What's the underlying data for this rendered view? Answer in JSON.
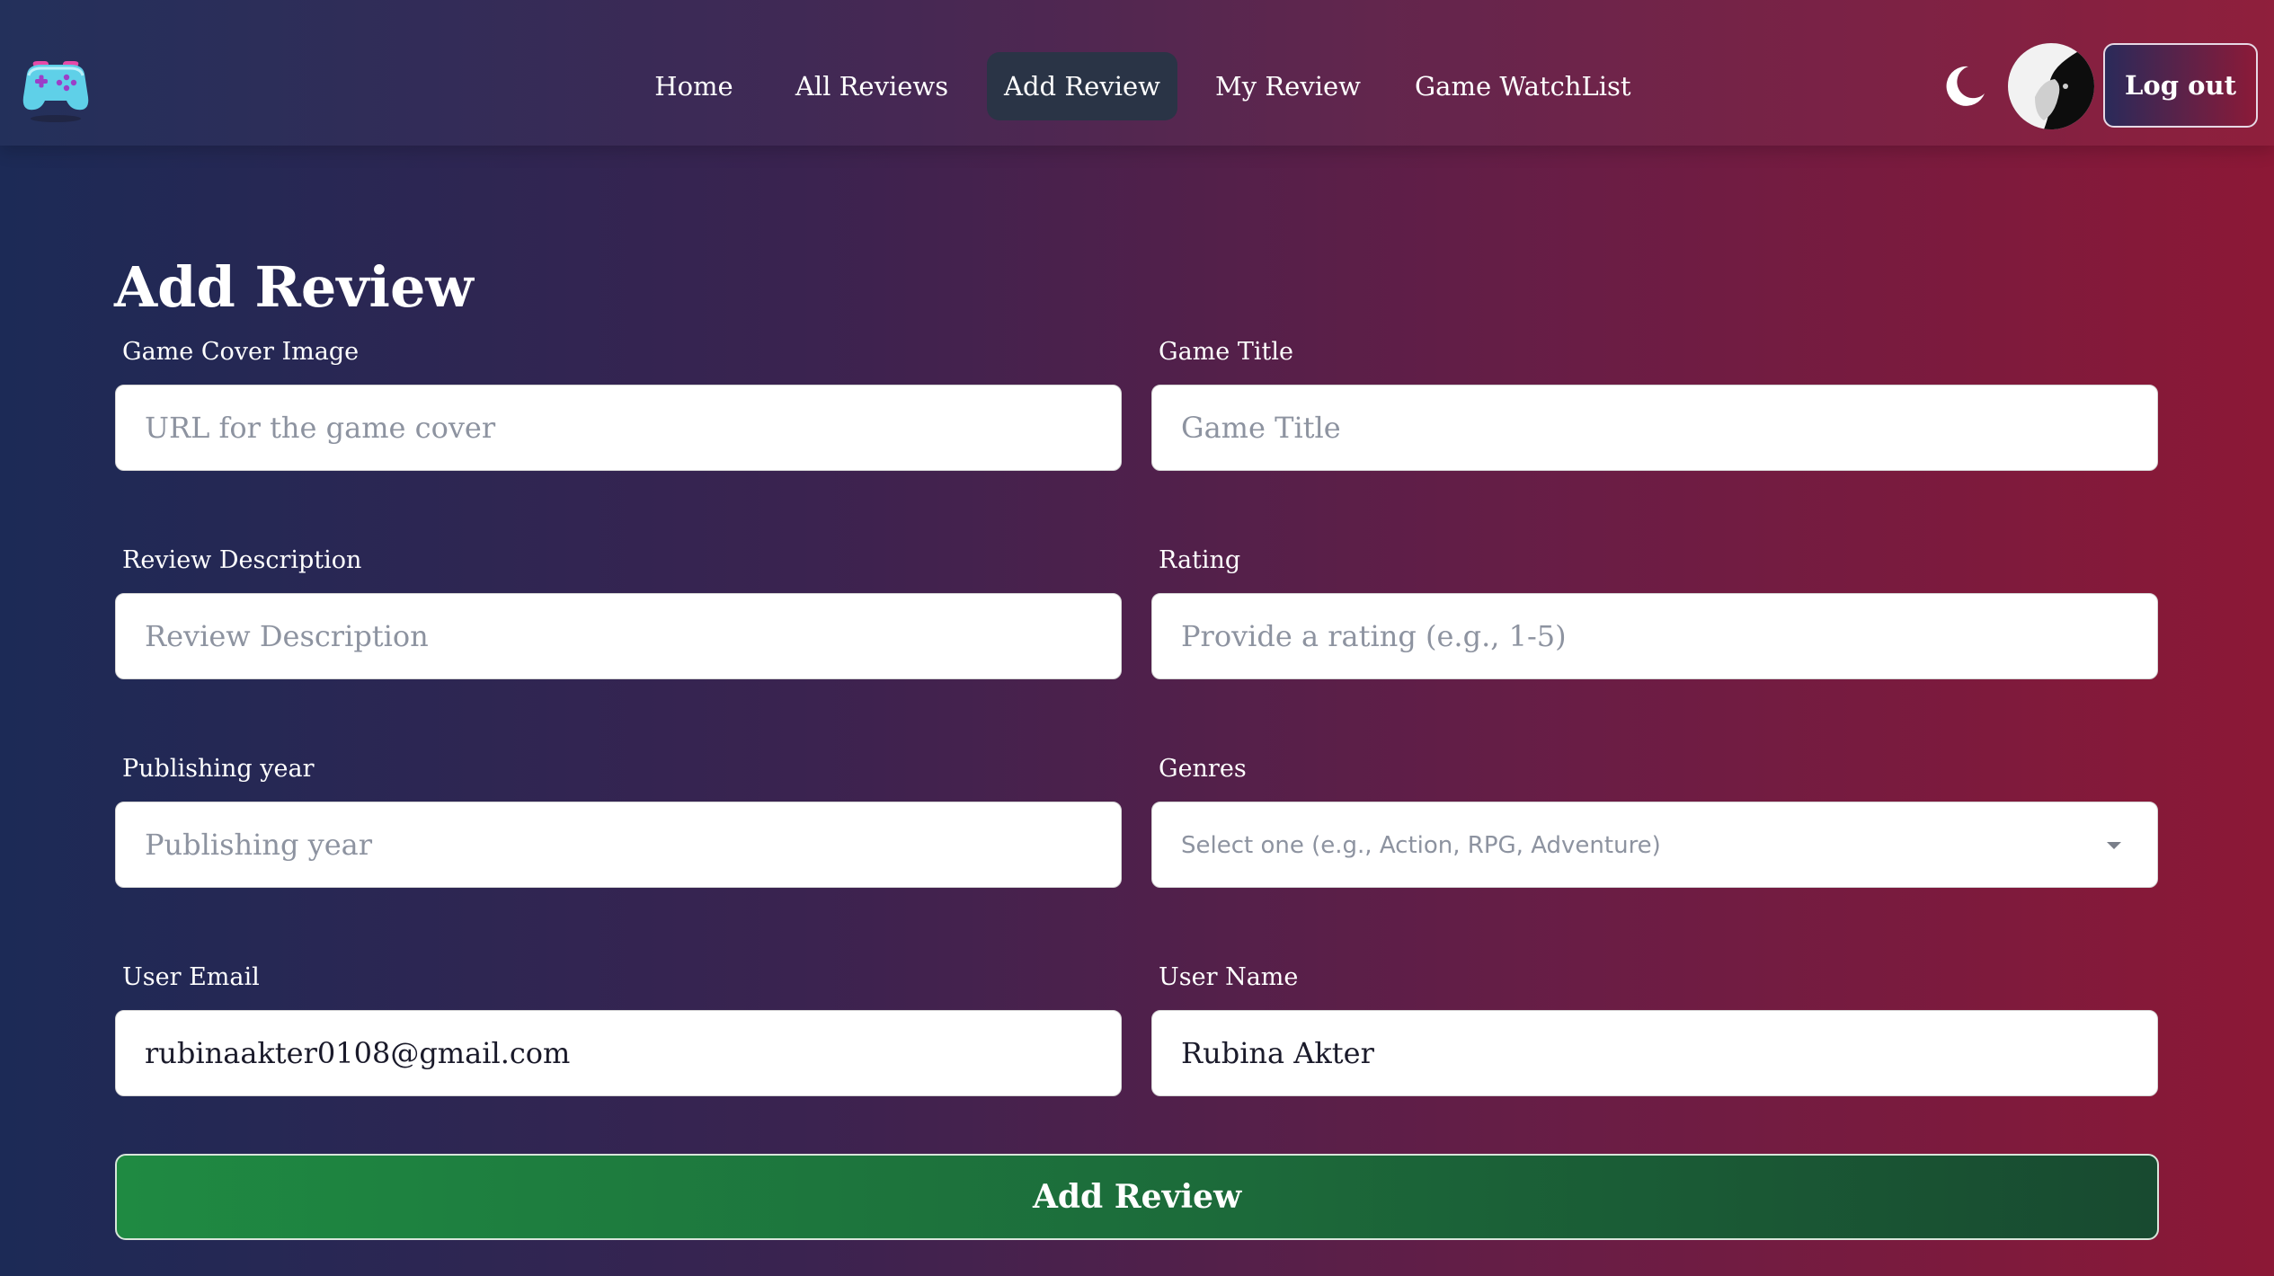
{
  "nav": {
    "items": [
      {
        "label": "Home"
      },
      {
        "label": "All Reviews"
      },
      {
        "label": "Add Review"
      },
      {
        "label": "My Review"
      },
      {
        "label": "Game WatchList"
      }
    ],
    "active_item": "Add Review",
    "logout_label": "Log out",
    "logo_icon": "gamepad-icon",
    "theme_icon": "moon-icon"
  },
  "form": {
    "title": "Add Review",
    "fields": {
      "cover": {
        "label": "Game Cover Image",
        "placeholder": "URL for the game cover",
        "value": ""
      },
      "title": {
        "label": "Game Title",
        "placeholder": "Game Title",
        "value": ""
      },
      "description": {
        "label": "Review Description",
        "placeholder": "Review Description",
        "value": ""
      },
      "rating": {
        "label": "Rating",
        "placeholder": "Provide a rating (e.g., 1-5)",
        "value": ""
      },
      "year": {
        "label": "Publishing year",
        "placeholder": "Publishing year",
        "value": ""
      },
      "genres": {
        "label": "Genres",
        "placeholder": "Select one (e.g., Action, RPG, Adventure)"
      },
      "email": {
        "label": "User Email",
        "value": "rubinaakter0108@gmail.com"
      },
      "name": {
        "label": "User Name",
        "value": "Rubina Akter"
      }
    },
    "submit_label": "Add Review"
  },
  "colors": {
    "gradient_left": "#1c2a56",
    "gradient_right": "#8c1836",
    "submit_green": "#1f8a42",
    "active_nav_bg": "#2a3446"
  }
}
